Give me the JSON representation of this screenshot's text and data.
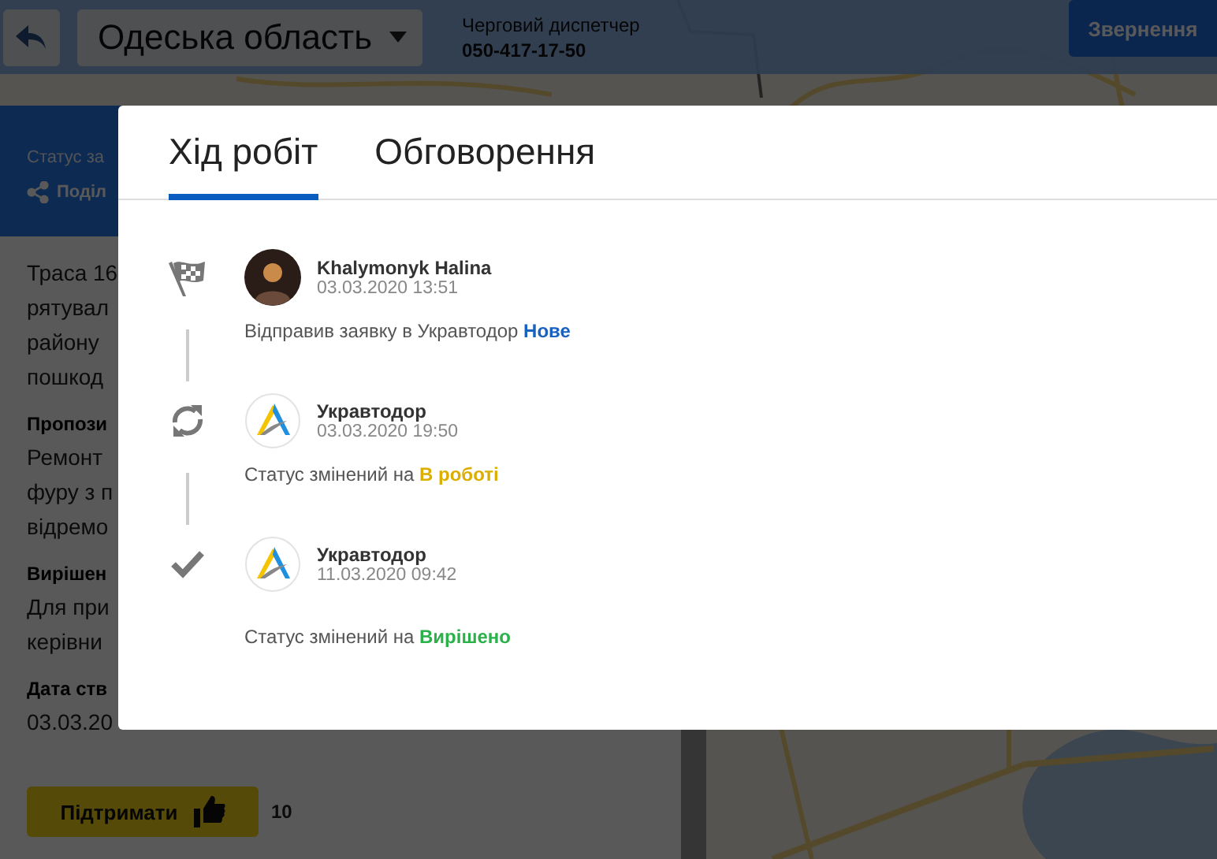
{
  "header": {
    "region": "Одеська область",
    "dispatcher_label": "Черговий диспетчер",
    "dispatcher_phone": "050-417-17-50",
    "requests_button": "Звернення"
  },
  "request_panel": {
    "status_label": "Статус за",
    "share_link": "Поділ",
    "description_lines": [
      "Траса 16",
      "рятувал",
      "району",
      "пошкод"
    ],
    "sections": [
      {
        "heading": "Пропози",
        "lines": [
          "Ремонт",
          "фуру з п",
          "відремо"
        ]
      },
      {
        "heading": "Вирішен",
        "lines": [
          "Для при",
          "керівни"
        ]
      },
      {
        "heading": "Дата ств",
        "lines": [
          "03.03.20"
        ]
      }
    ],
    "support_button": "Підтримати",
    "support_count": "10"
  },
  "modal": {
    "tabs": [
      {
        "label": "Хід робіт",
        "selected": true
      },
      {
        "label": "Обговорення",
        "selected": false
      }
    ],
    "events": [
      {
        "kind": "flag",
        "avatar": {
          "kind": "person"
        },
        "author": "Khalymonyk Halina",
        "time": "03.03.2020 13:51",
        "message": "Відправив заявку в Укравтодор",
        "status": "Нове",
        "color": "#1a62c0"
      },
      {
        "kind": "refresh",
        "avatar": {
          "kind": "logo"
        },
        "author": "Укравтодор",
        "time": "03.03.2020 19:50",
        "message": "Статус змінений на",
        "status": "В роботі",
        "color": "#dcae00"
      },
      {
        "kind": "check",
        "avatar": {
          "kind": "logo"
        },
        "author": "Укравтодор",
        "time": "11.03.2020 09:42",
        "message": "Статус змінений на",
        "status": "Вирішено",
        "color": "#2bb14a"
      }
    ]
  }
}
